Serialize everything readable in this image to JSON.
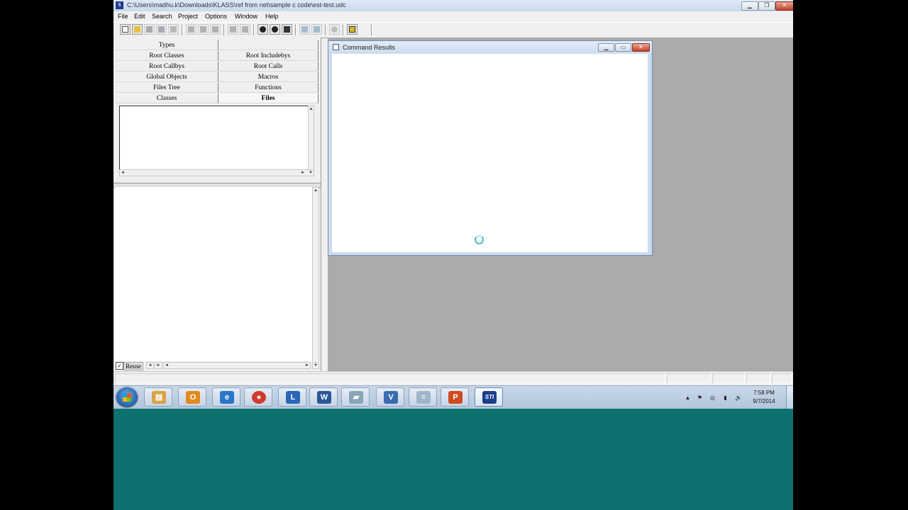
{
  "window": {
    "title": "C:\\Users\\madhu.k\\Downloads\\KLASS\\ref from net\\sample c code\\est-test.udc",
    "app_icon_text": "S",
    "controls": {
      "minimize": "▁",
      "restore": "❐",
      "close": "✕"
    }
  },
  "menu": [
    "File",
    "Edit",
    "Search",
    "Project",
    "Options",
    "Window",
    "Help"
  ],
  "toolbar": {
    "icons": [
      "new-file-icon",
      "open-folder-icon",
      "save-icon",
      "save-all-icon",
      "print-icon",
      "cut-icon",
      "copy-icon",
      "paste-icon",
      "undo-icon",
      "redo-icon",
      "find-icon",
      "find-in-files-icon",
      "replace-icon",
      "back-icon",
      "forward-icon",
      "zoom-icon",
      "database-icon"
    ]
  },
  "browser_tabs": {
    "left": [
      "Types",
      "Root Classes",
      "Root Callbys",
      "Global Objects",
      "Files Tree",
      "Classes"
    ],
    "right": [
      "",
      "Root Includebys",
      "Root Calls",
      "Macros",
      "Functions",
      "Files"
    ],
    "active": "Files"
  },
  "reuse": {
    "label": "Reuse",
    "checked": true,
    "check_glyph": "✓"
  },
  "scroll_glyphs": {
    "up": "▲",
    "down": "▼",
    "left": "◄",
    "right": "►"
  },
  "command_results": {
    "title": "Command Results",
    "controls": {
      "minimize": "▁",
      "restore": "▭",
      "close": "✕"
    }
  },
  "taskbar": {
    "items": [
      {
        "name": "explorer",
        "glyph": "▤",
        "color": "#d9a441"
      },
      {
        "name": "outlook",
        "glyph": "O",
        "color": "#e28a1e"
      },
      {
        "name": "internet-explorer",
        "glyph": "e",
        "color": "#2a77c9"
      },
      {
        "name": "chrome",
        "glyph": "●",
        "color": "#d13b2f"
      },
      {
        "name": "lync",
        "glyph": "L",
        "color": "#2a67b8"
      },
      {
        "name": "word",
        "glyph": "W",
        "color": "#2b5797"
      },
      {
        "name": "app-gray",
        "glyph": "▰",
        "color": "#8aa5b5"
      },
      {
        "name": "visio",
        "glyph": "V",
        "color": "#3a6bb0"
      },
      {
        "name": "notepad",
        "glyph": "≡",
        "color": "#9fb6c9"
      },
      {
        "name": "powerpoint",
        "glyph": "P",
        "color": "#d04a21"
      },
      {
        "name": "sti",
        "glyph": "STI",
        "color": "#1d3d8c"
      }
    ],
    "tray_icons": [
      "▲",
      "⚑",
      "◎",
      "▮",
      "🔊"
    ],
    "clock_time": "7:58 PM",
    "clock_date": "9/7/2014"
  }
}
